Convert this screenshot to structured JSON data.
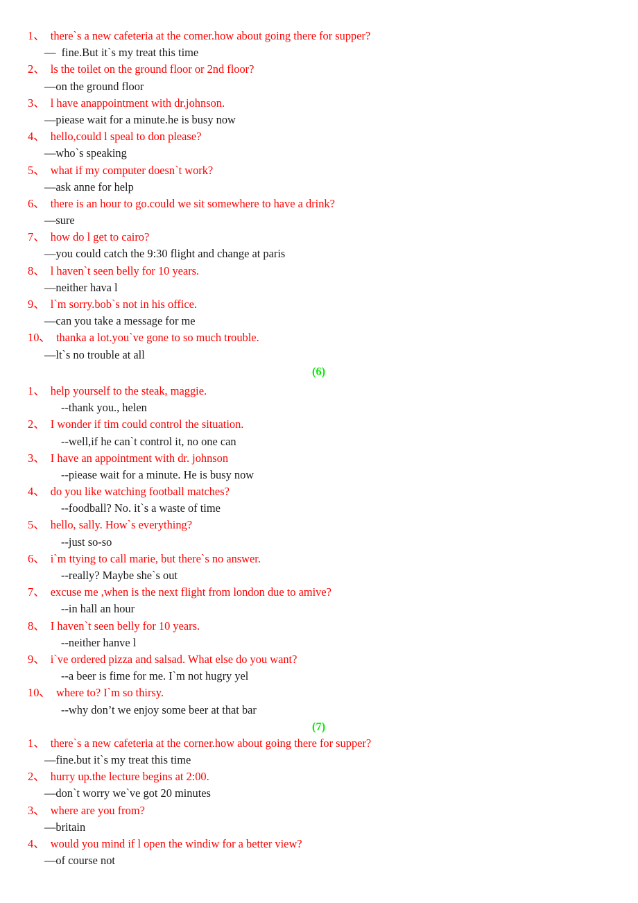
{
  "document": {
    "type": "english-dialogue-practice-worksheet",
    "colors": {
      "question_text": "#ff0000",
      "answer_text": "#1a1a1a",
      "section_marker": "#00ee00",
      "page_background": "#ffffff"
    }
  },
  "sections": [
    {
      "id": "section-5",
      "marker": "",
      "answer_prefix_style": "em-dash",
      "items": [
        {
          "number": "1、",
          "question": "there`s a new cafeteria at the comer.how about going there for supper?",
          "answer": "—  fine.But it`s my treat this time"
        },
        {
          "number": "2、",
          "question": "ls the toilet on the ground floor or 2nd floor?",
          "answer": "—on the ground floor"
        },
        {
          "number": "3、",
          "question": "l have anappointment with dr.johnson.",
          "answer": "—piease wait for a minute.he is busy now"
        },
        {
          "number": "4、",
          "question": "hello,could l speal to don please?",
          "answer": "—who`s speaking"
        },
        {
          "number": "5、",
          "question": "what if my computer doesn`t work?",
          "answer": "—ask anne for help"
        },
        {
          "number": "6、",
          "question": "there is an hour to go.could we sit somewhere to have a drink?",
          "answer": "—sure"
        },
        {
          "number": "7、",
          "question": "how do l get to cairo?",
          "answer": "—you could catch the 9:30 flight and change at paris"
        },
        {
          "number": "8、",
          "question": "l haven`t seen belly for 10 years.",
          "answer": "—neither hava l"
        },
        {
          "number": "9、",
          "question": "l`m sorry.bob`s not in his office.",
          "answer": "—can you take a message for me"
        },
        {
          "number": "10、",
          "question": "thanka a lot.you`ve gone to so much trouble.",
          "answer": "—lt`s no trouble at all"
        }
      ]
    },
    {
      "id": "section-6",
      "marker": "(6)",
      "answer_prefix_style": "double-hyphen",
      "items": [
        {
          "number": "1、",
          "question": "help yourself to the steak, maggie.",
          "answer": "--thank you., helen"
        },
        {
          "number": "2、",
          "question": "I wonder if tim could control the situation.",
          "answer": "--well,if he can`t control it, no one can"
        },
        {
          "number": "3、",
          "question": "I have an appointment with dr. johnson",
          "answer": "--piease wait for a minute. He is busy now"
        },
        {
          "number": "4、",
          "question": "do you like watching football matches?",
          "answer": "--foodball? No. it`s a waste of time"
        },
        {
          "number": "5、",
          "question": "hello, sally. How`s everything?",
          "answer": "--just so-so"
        },
        {
          "number": "6、",
          "question": "i`m ttying to call marie, but there`s no answer.",
          "answer": "--really? Maybe she`s out"
        },
        {
          "number": "7、",
          "question": "excuse me ,when is the next flight from london due to amive?",
          "answer": "--in hall an hour"
        },
        {
          "number": "8、",
          "question": "I haven`t seen belly for 10 years.",
          "answer": "--neither hanve l"
        },
        {
          "number": "9、",
          "question": "i`ve ordered pizza and salsad. What else do you want?",
          "answer": "--a beer is fime for me. I`m not hugry yel"
        },
        {
          "number": "10、",
          "question": "where to? I`m so thirsy.",
          "answer": "--why don’t we enjoy some beer at that bar"
        }
      ]
    },
    {
      "id": "section-7",
      "marker": "(7)",
      "answer_prefix_style": "em-dash",
      "items": [
        {
          "number": "1、",
          "question": "there`s a new cafeteria at the corner.how about going there for supper?",
          "answer": "—fine.but it`s my treat this time"
        },
        {
          "number": "2、",
          "question": "hurry up.the lecture begins at 2:00.",
          "answer": "—don`t worry we`ve got 20 minutes"
        },
        {
          "number": "3、",
          "question": "where are you from?",
          "answer": "—britain"
        },
        {
          "number": "4、",
          "question": "would you mind if l open the windiw for a better view?",
          "answer": "—of course not"
        }
      ]
    }
  ]
}
